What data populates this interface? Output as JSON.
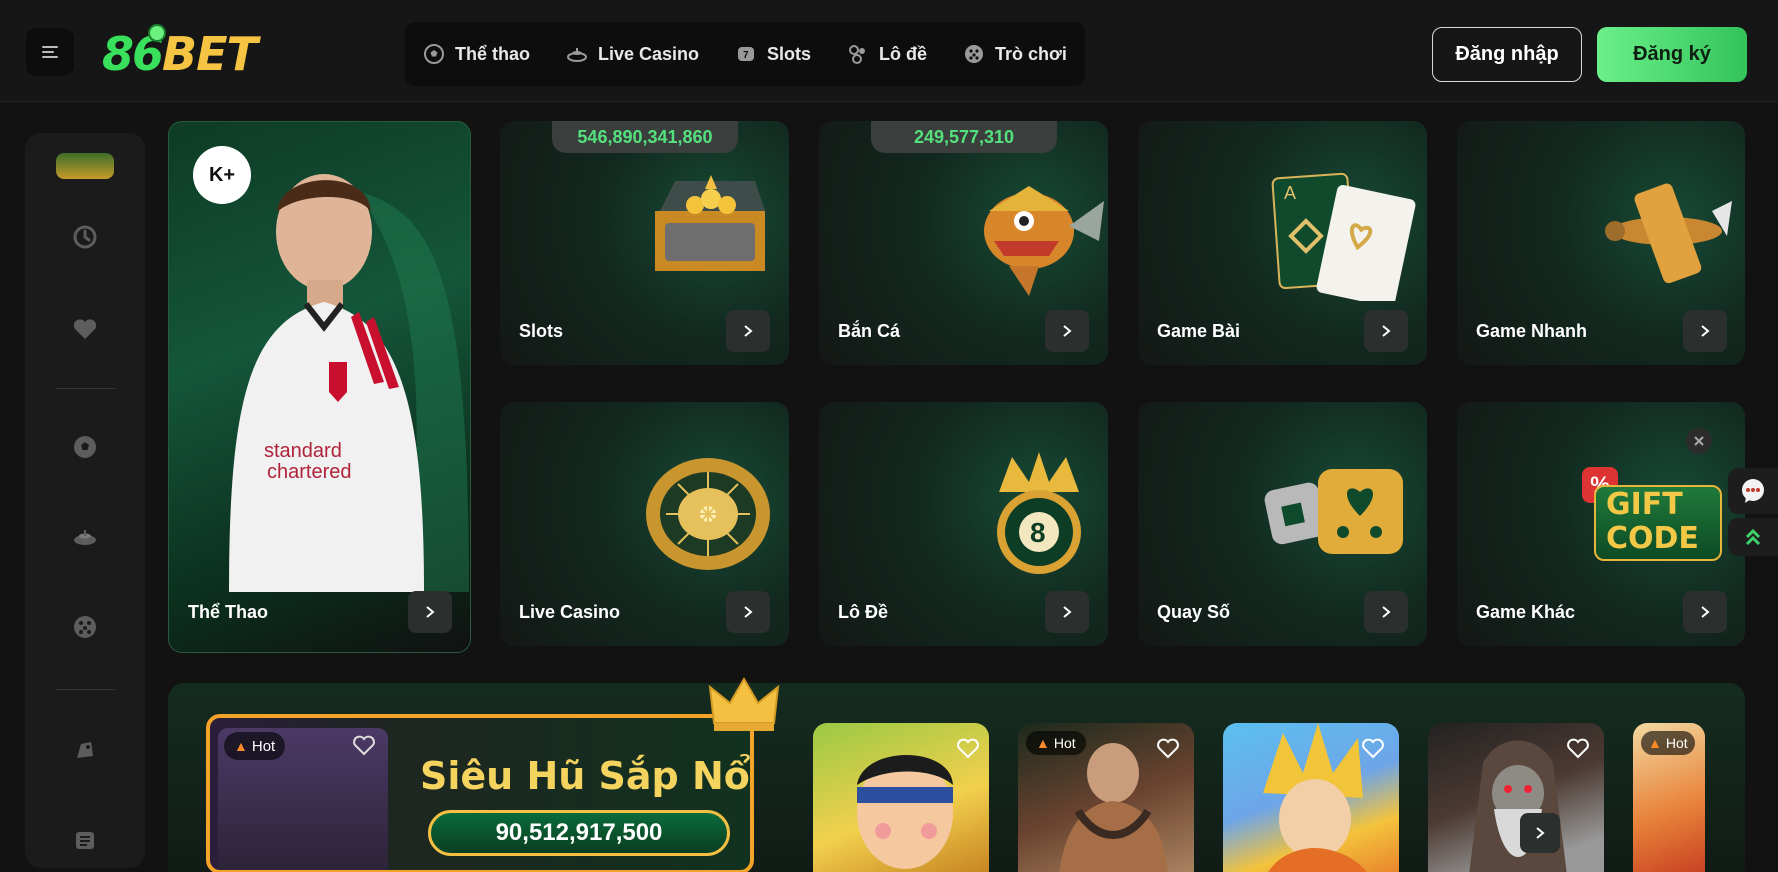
{
  "header": {
    "logo_numbers": "86",
    "logo_text": "BET",
    "nav": [
      {
        "label": "Thể thao",
        "icon": "soccer-ball-icon"
      },
      {
        "label": "Live Casino",
        "icon": "casino-chip-icon"
      },
      {
        "label": "Slots",
        "icon": "slot-machine-icon"
      },
      {
        "label": "Lô đề",
        "icon": "lottery-balls-icon"
      },
      {
        "label": "Trò chơi",
        "icon": "dice-icon"
      }
    ],
    "login_label": "Đăng nhập",
    "register_label": "Đăng ký"
  },
  "sidebar": {
    "icons": [
      "history-icon",
      "heart-icon",
      "soccer-ball-icon",
      "casino-chip-icon",
      "dice-icon",
      "promotions-icon",
      "news-icon"
    ]
  },
  "cards": {
    "sport": {
      "label": "Thể Thao",
      "badge": "K+"
    },
    "slots": {
      "label": "Slots",
      "jackpot": "546,890,341,860"
    },
    "ban_ca": {
      "label": "Bắn Cá",
      "jackpot": "249,577,310"
    },
    "game_bai": {
      "label": "Game Bài"
    },
    "game_nhanh": {
      "label": "Game Nhanh"
    },
    "live_casino": {
      "label": "Live Casino"
    },
    "lo_de": {
      "label": "Lô Đề"
    },
    "quay_so": {
      "label": "Quay Số"
    },
    "game_khac": {
      "label": "Game Khác"
    }
  },
  "gift_code": {
    "line1": "GIFT",
    "line2": "CODE",
    "percent": "%"
  },
  "promo": {
    "hot_label": "Hot",
    "title": "Siêu Hũ Sắp Nổ",
    "amount": "90,512,917,500"
  },
  "thumbs": [
    {
      "hot": false
    },
    {
      "hot": true,
      "hot_label": "Hot"
    },
    {
      "hot": false
    },
    {
      "hot": false
    },
    {
      "hot": true,
      "hot_label": "Hot"
    }
  ],
  "colors": {
    "accent_green": "#38e05c",
    "brand_gold": "#f6c443",
    "register_bg": "#4fd872",
    "jackpot_green": "#55e07e"
  }
}
